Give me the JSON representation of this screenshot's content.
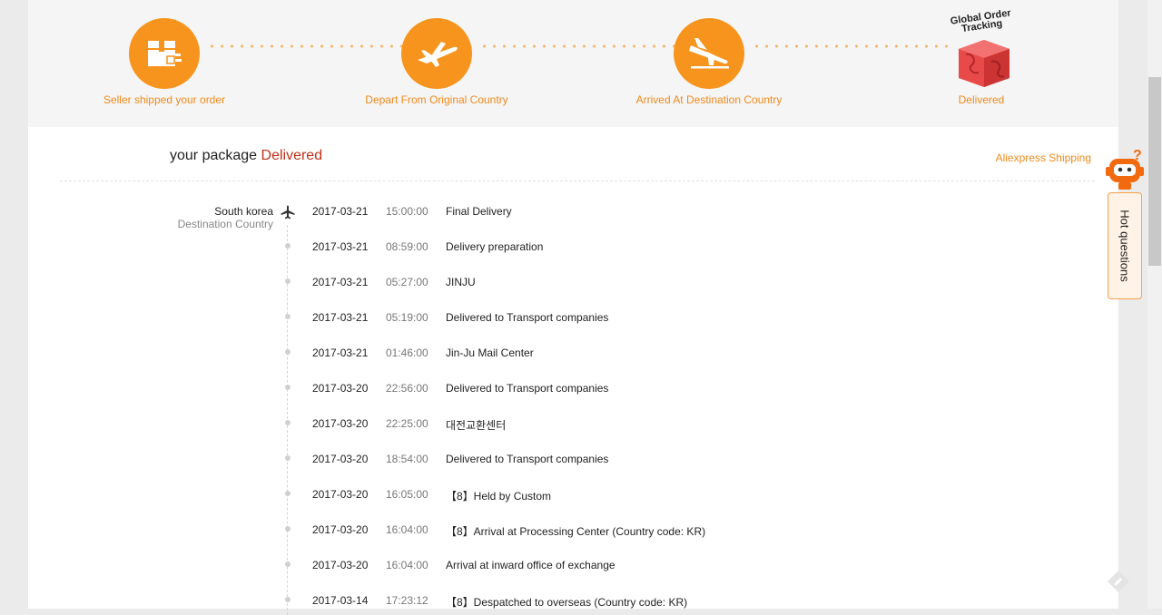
{
  "progress": {
    "steps": [
      {
        "label": "Seller shipped your order",
        "icon": "package-box-icon"
      },
      {
        "label": "Depart From Original Country",
        "icon": "plane-takeoff-icon"
      },
      {
        "label": "Arrived At Destination Country",
        "icon": "plane-landing-icon"
      },
      {
        "label": "Delivered",
        "icon": "global-order-tracking-icon",
        "image_text": "Global Order Tracking"
      }
    ]
  },
  "package": {
    "prefix": "your package",
    "status": "Delivered",
    "shipping_link": "Aliexpress Shipping"
  },
  "location": {
    "country": "South korea",
    "label": "Destination Country",
    "icon": "airplane-icon"
  },
  "events": [
    {
      "date": "2017-03-21",
      "time": "15:00:00",
      "desc": "Final Delivery"
    },
    {
      "date": "2017-03-21",
      "time": "08:59:00",
      "desc": "Delivery preparation"
    },
    {
      "date": "2017-03-21",
      "time": "05:27:00",
      "desc": "JINJU"
    },
    {
      "date": "2017-03-21",
      "time": "05:19:00",
      "desc": "Delivered to Transport companies"
    },
    {
      "date": "2017-03-21",
      "time": "01:46:00",
      "desc": "Jin-Ju Mail Center"
    },
    {
      "date": "2017-03-20",
      "time": "22:56:00",
      "desc": "Delivered to Transport companies"
    },
    {
      "date": "2017-03-20",
      "time": "22:25:00",
      "desc": "대전교환센터"
    },
    {
      "date": "2017-03-20",
      "time": "18:54:00",
      "desc": "Delivered to Transport companies"
    },
    {
      "date": "2017-03-20",
      "time": "16:05:00",
      "desc": "【8】Held by Custom"
    },
    {
      "date": "2017-03-20",
      "time": "16:04:00",
      "desc": "【8】Arrival at Processing Center (Country code: KR)"
    },
    {
      "date": "2017-03-20",
      "time": "16:04:00",
      "desc": "Arrival at inward office of exchange"
    },
    {
      "date": "2017-03-14",
      "time": "17:23:12",
      "desc": "【8】Despatched to overseas (Country code: KR)"
    }
  ],
  "side": {
    "hot_questions": "Hot questions",
    "assistant_icon": "robot-assistant-icon",
    "feedback_icon": "feedback-icon"
  },
  "colors": {
    "accent": "#f7941d",
    "status": "#c0311a",
    "link": "#f08a1c"
  }
}
